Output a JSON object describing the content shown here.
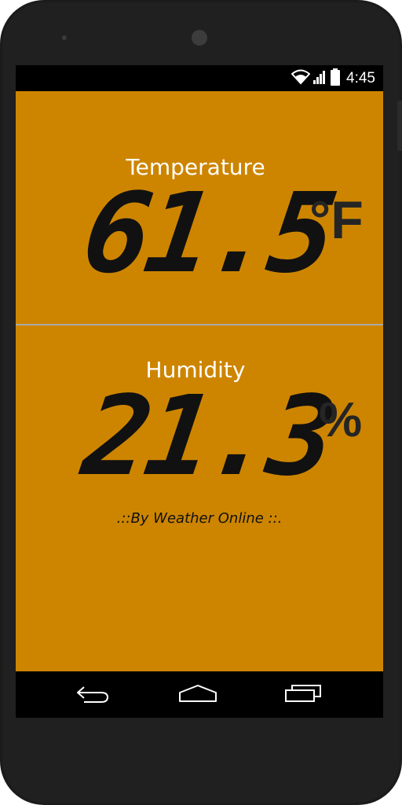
{
  "status_bar": {
    "time": "4:45",
    "icons": [
      "wifi-icon",
      "signal-icon",
      "battery-icon"
    ]
  },
  "temperature": {
    "label": "Temperature",
    "value": "61.5",
    "unit": "°F"
  },
  "humidity": {
    "label": "Humidity",
    "value": "21.3",
    "unit": "%"
  },
  "credit": ".::By Weather Online ::.",
  "navigation": {
    "buttons": [
      "back-icon",
      "home-icon",
      "recents-icon"
    ]
  },
  "colors": {
    "background": "#cd8500",
    "divider": "#a9a9a9",
    "digits": "#111111",
    "label": "#ffffff",
    "bars": "#000000"
  }
}
